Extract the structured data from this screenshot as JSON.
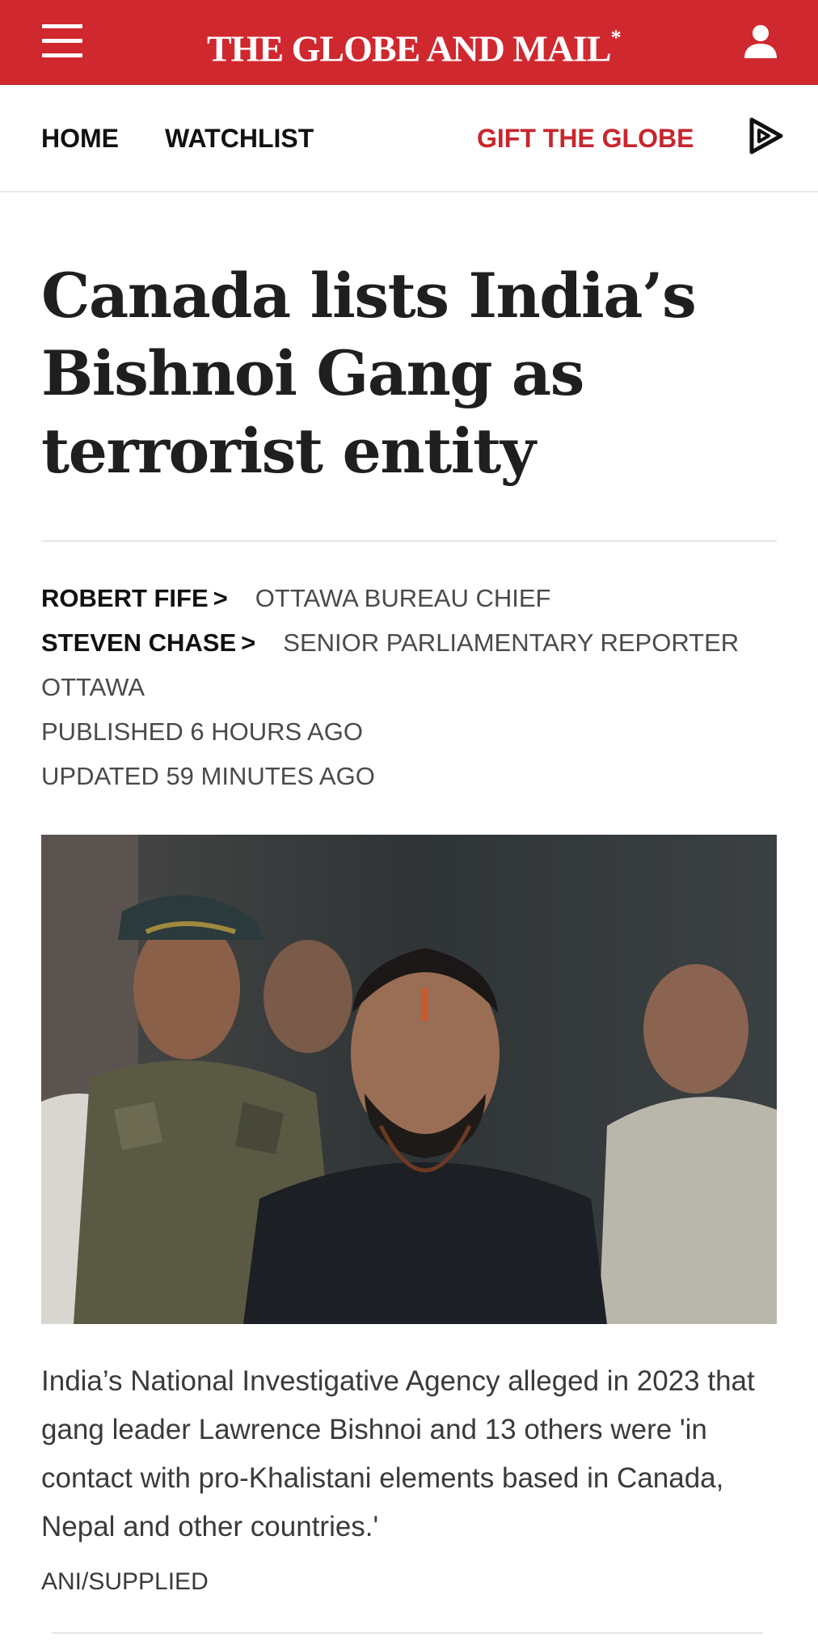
{
  "header": {
    "brand": "THE GLOBE AND MAIL",
    "brand_mark": "*",
    "menu_icon": "hamburger-menu-icon",
    "account_icon": "user-account-icon",
    "background_color": "#d0282f"
  },
  "nav": {
    "home": "HOME",
    "watchlist": "WATCHLIST",
    "gift": "GIFT THE GLOBE",
    "gift_color": "#c8262d",
    "listen_icon": "play-audio-icon"
  },
  "article": {
    "headline": "Canada lists India’s Bishnoi Gang as terrorist entity",
    "authors": [
      {
        "name": "ROBERT FIFE",
        "role": "OTTAWA BUREAU CHIEF"
      },
      {
        "name": "STEVEN CHASE",
        "role": "SENIOR PARLIAMENTARY REPORTER"
      }
    ],
    "chevron": ">",
    "dateline": "OTTAWA",
    "published": "PUBLISHED 6 HOURS AGO",
    "updated": "UPDATED 59 MINUTES AGO",
    "caption": "India’s National Investigative Agency alleged in 2023 that gang leader Lawrence Bishnoi and 13 others were 'in contact with pro-Khalistani elements based in Canada, Nepal and other countries.'",
    "credit": "ANI/SUPPLIED"
  }
}
